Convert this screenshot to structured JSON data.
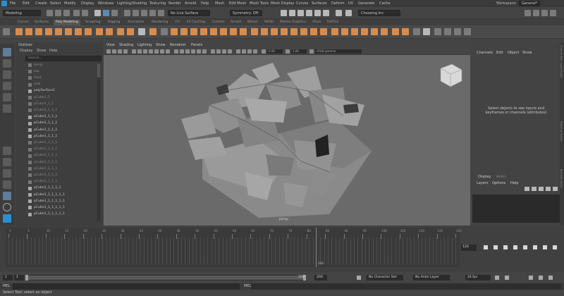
{
  "menubar": {
    "items": [
      "File",
      "Edit",
      "Create",
      "Select",
      "Modify",
      "Display",
      "Windows",
      "Lighting/Shading",
      "Texturing",
      "Render",
      "Arnold",
      "Help",
      "Mesh",
      "Edit Mesh",
      "Mesh Tools",
      "Mesh Display",
      "Curves",
      "Surfaces",
      "Deform",
      "UV",
      "Generate",
      "Cache"
    ],
    "visible_items": [
      "File",
      "Edit",
      "Create",
      "Select",
      "Modify",
      "Display",
      "Windows",
      "Lighting/Shading",
      "Texturing",
      "Render",
      "Arnold",
      "Help"
    ],
    "workspace_label": "Workspace:",
    "workspace_value": "General*"
  },
  "statusline": {
    "menuset": "Modeling",
    "live_surface": "No Live Surface",
    "symmetry": "Symmetry: Off",
    "login": "Choosing Inc"
  },
  "shelf_tabs": [
    "Curves",
    "Surfaces",
    "Poly Modeling",
    "Sculpting",
    "Rigging",
    "Animation",
    "Rendering",
    "FX",
    "FX Caching",
    "Custom",
    "Arnold",
    "Bifrost",
    "MASH",
    "Motion Graphics",
    "XGen",
    "TURTLE"
  ],
  "shelf_active": "Poly Modeling",
  "outliner": {
    "title": "Outliner",
    "menu": [
      "Display",
      "Show",
      "Help"
    ],
    "search_placeholder": "Search...",
    "items": [
      {
        "label": "persp",
        "dim": true
      },
      {
        "label": "top",
        "dim": true
      },
      {
        "label": "front",
        "dim": true
      },
      {
        "label": "side",
        "dim": true
      },
      {
        "label": "polySurface1",
        "dim": false
      },
      {
        "label": "pCube1_1",
        "dim": true
      },
      {
        "label": "pCube1_1_1",
        "dim": true
      },
      {
        "label": "pCube1_1_1_1",
        "dim": true
      },
      {
        "label": "pCube1_1_1_1",
        "dim": false
      },
      {
        "label": "pCube1_1_1_1",
        "dim": false
      },
      {
        "label": "pCube1_1_1_1",
        "dim": false
      },
      {
        "label": "pCube1_1_1_1",
        "dim": false
      },
      {
        "label": "pCube1_1_1_1",
        "dim": true
      },
      {
        "label": "pCube1_1_1_1",
        "dim": true
      },
      {
        "label": "pCube1_1_1_1",
        "dim": true
      },
      {
        "label": "pCube1_1_1_1",
        "dim": true
      },
      {
        "label": "pCube1_1_1_1",
        "dim": true
      },
      {
        "label": "pCube1_1_1_1",
        "dim": true
      },
      {
        "label": "pCube1_1_1_1",
        "dim": true
      },
      {
        "label": "pCube1_1_1_1_1",
        "dim": false
      },
      {
        "label": "pCube1_1_1_1_1_1",
        "dim": false
      },
      {
        "label": "pCube1_1_1_1_1_1",
        "dim": false
      },
      {
        "label": "pCube1_1_1_1_1_1",
        "dim": false
      },
      {
        "label": "pCube1_1_1_1_1_1",
        "dim": false
      }
    ]
  },
  "viewport": {
    "menu": [
      "View",
      "Shading",
      "Lighting",
      "Show",
      "Renderer",
      "Panels"
    ],
    "camera_label": "persp",
    "colorspace": "sRGB gamma"
  },
  "channelbox": {
    "tabs": [
      "Channels",
      "Edit",
      "Object",
      "Show"
    ],
    "message": "Select objects to see inputs and keyframes or channels (attributes)",
    "layer_tabs": [
      "Display",
      "Anim"
    ],
    "layer_menu": [
      "Layers",
      "Options",
      "Help"
    ]
  },
  "side_tabs": [
    "Channel Box / Layer Editor",
    "Modeling Toolkit",
    "Attribute Editor"
  ],
  "timeslider": {
    "ticks": [
      "1",
      "5",
      "10",
      "15",
      "20",
      "25",
      "30",
      "35",
      "40",
      "45",
      "50",
      "55",
      "60",
      "65",
      "70",
      "75",
      "80",
      "85",
      "90",
      "95",
      "100",
      "105",
      "110",
      "115",
      "120"
    ],
    "current_frame": "120",
    "frame_field": "120"
  },
  "rangebar": {
    "start": "1",
    "inner_start": "1",
    "inner_end": "200",
    "end": "200",
    "character_set": "No Character Set",
    "anim_layer": "No Anim Layer",
    "fps": "24 fps"
  },
  "cmdline": {
    "lang": "MEL",
    "lang2": "MEL"
  },
  "helpline": {
    "text": "Select Tool: select an object"
  }
}
